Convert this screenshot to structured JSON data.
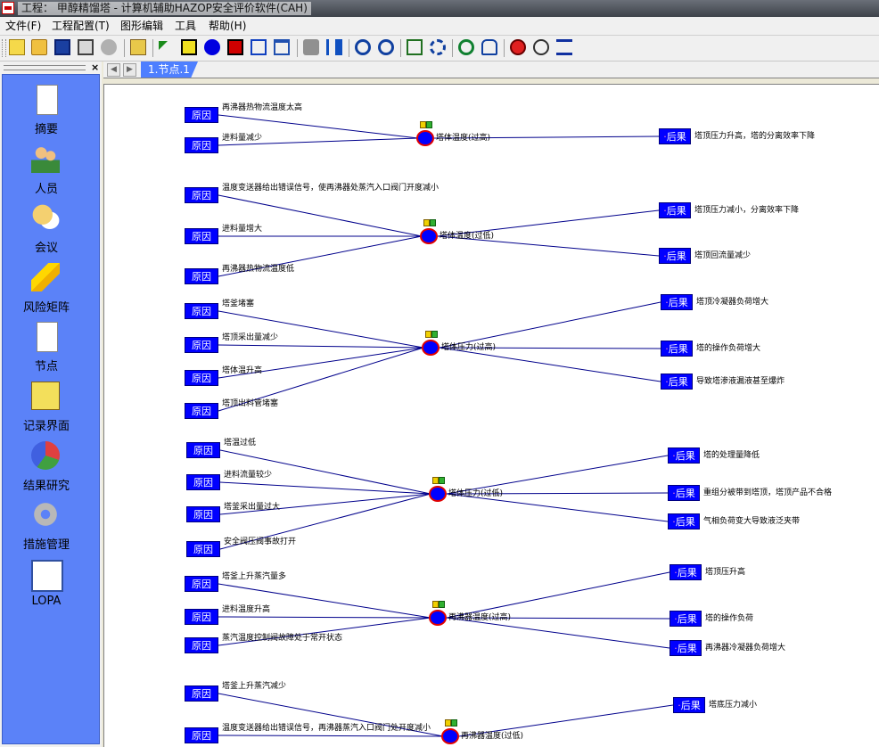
{
  "window": {
    "title": "工程： 甲醇精馏塔 - 计算机辅助HAZOP安全评价软件(CAH)"
  },
  "menu": [
    "文件(F)",
    "工程配置(T)",
    "图形编辑",
    "工具",
    "帮助(H)"
  ],
  "toolbar_icons": [
    "new-icon",
    "open-icon",
    "save-icon",
    "print-icon",
    "pie-icon",
    "folder-icon",
    "pointer-icon",
    "cause-tool-icon",
    "deviation-tool-icon",
    "effect-tool-icon",
    "link-icon",
    "delete-icon",
    "puzzle-icon",
    "first-icon",
    "zoom-in-icon",
    "zoom-out-icon",
    "fit-icon",
    "refresh-icon",
    "sync-icon",
    "hand-icon",
    "alert-icon",
    "speech-icon",
    "list-icon"
  ],
  "nav": [
    {
      "label": "摘要",
      "icon": "document-icon"
    },
    {
      "label": "人员",
      "icon": "people-icon"
    },
    {
      "label": "会议",
      "icon": "chat-icon"
    },
    {
      "label": "风险矩阵",
      "icon": "lightning-icon"
    },
    {
      "label": "节点",
      "icon": "node-icon"
    },
    {
      "label": "记录界面",
      "icon": "record-icon",
      "selected": true
    },
    {
      "label": "结果研究",
      "icon": "pie-chart-icon"
    },
    {
      "label": "措施管理",
      "icon": "gear-icon"
    },
    {
      "label": "LOPA",
      "icon": "lopa-icon"
    }
  ],
  "tab": {
    "label": "1.节点.1"
  },
  "labels": {
    "cause": "原因",
    "effect_dot": "·",
    "effect": "后果"
  },
  "colors": {
    "box": "#0000ff",
    "line": "#00008b",
    "deviation_ring": "#e00000",
    "nav_bg": "#5b82f8",
    "tab": "#4e7fff"
  },
  "groups": [
    {
      "deviation": "塔体温度(过高)",
      "causes": [
        "再沸器热物流温度太高",
        "进料量减少"
      ],
      "effects": [
        "塔顶压力升高，塔的分离效率下降"
      ]
    },
    {
      "deviation": "塔体温度(过低)",
      "causes": [
        "温度变送器给出错误信号，使再沸器处蒸汽入口阀门开度减小",
        "进料量增大",
        "再沸器热物流温度低"
      ],
      "effects": [
        "塔顶压力减小，分离效率下降",
        "塔顶回流量减少"
      ]
    },
    {
      "deviation": "塔体压力(过高)",
      "causes": [
        "塔釜堵塞",
        "塔顶采出量减少",
        "塔体温升高",
        "塔顶出料管堵塞"
      ],
      "effects": [
        "塔顶冷凝器负荷增大",
        "塔的操作负荷增大",
        "导致塔渗液漏液甚至爆炸"
      ]
    },
    {
      "deviation": "塔体压力(过低)",
      "causes": [
        "塔温过低",
        "进料流量较少",
        "塔釜采出量过大",
        "安全阀压阀事故打开"
      ],
      "effects": [
        "塔的处理量降低",
        "重组分被带到塔顶，塔顶产品不合格",
        "气相负荷变大导致液泛夹带"
      ]
    },
    {
      "deviation": "再沸器温度(过高)",
      "causes": [
        "塔釜上升蒸汽量多",
        "进料温度升高",
        "蒸汽温度控制阀故障处于常开状态"
      ],
      "effects": [
        "塔顶压升高",
        "塔的操作负荷",
        "再沸器冷凝器负荷增大"
      ]
    },
    {
      "deviation": "再沸器温度(过低)",
      "causes": [
        "塔釜上升蒸汽减少",
        "温度变送器给出错误信号，再沸器蒸汽入口阀门处开度减小"
      ],
      "effects": [
        "塔底压力减小"
      ]
    }
  ]
}
